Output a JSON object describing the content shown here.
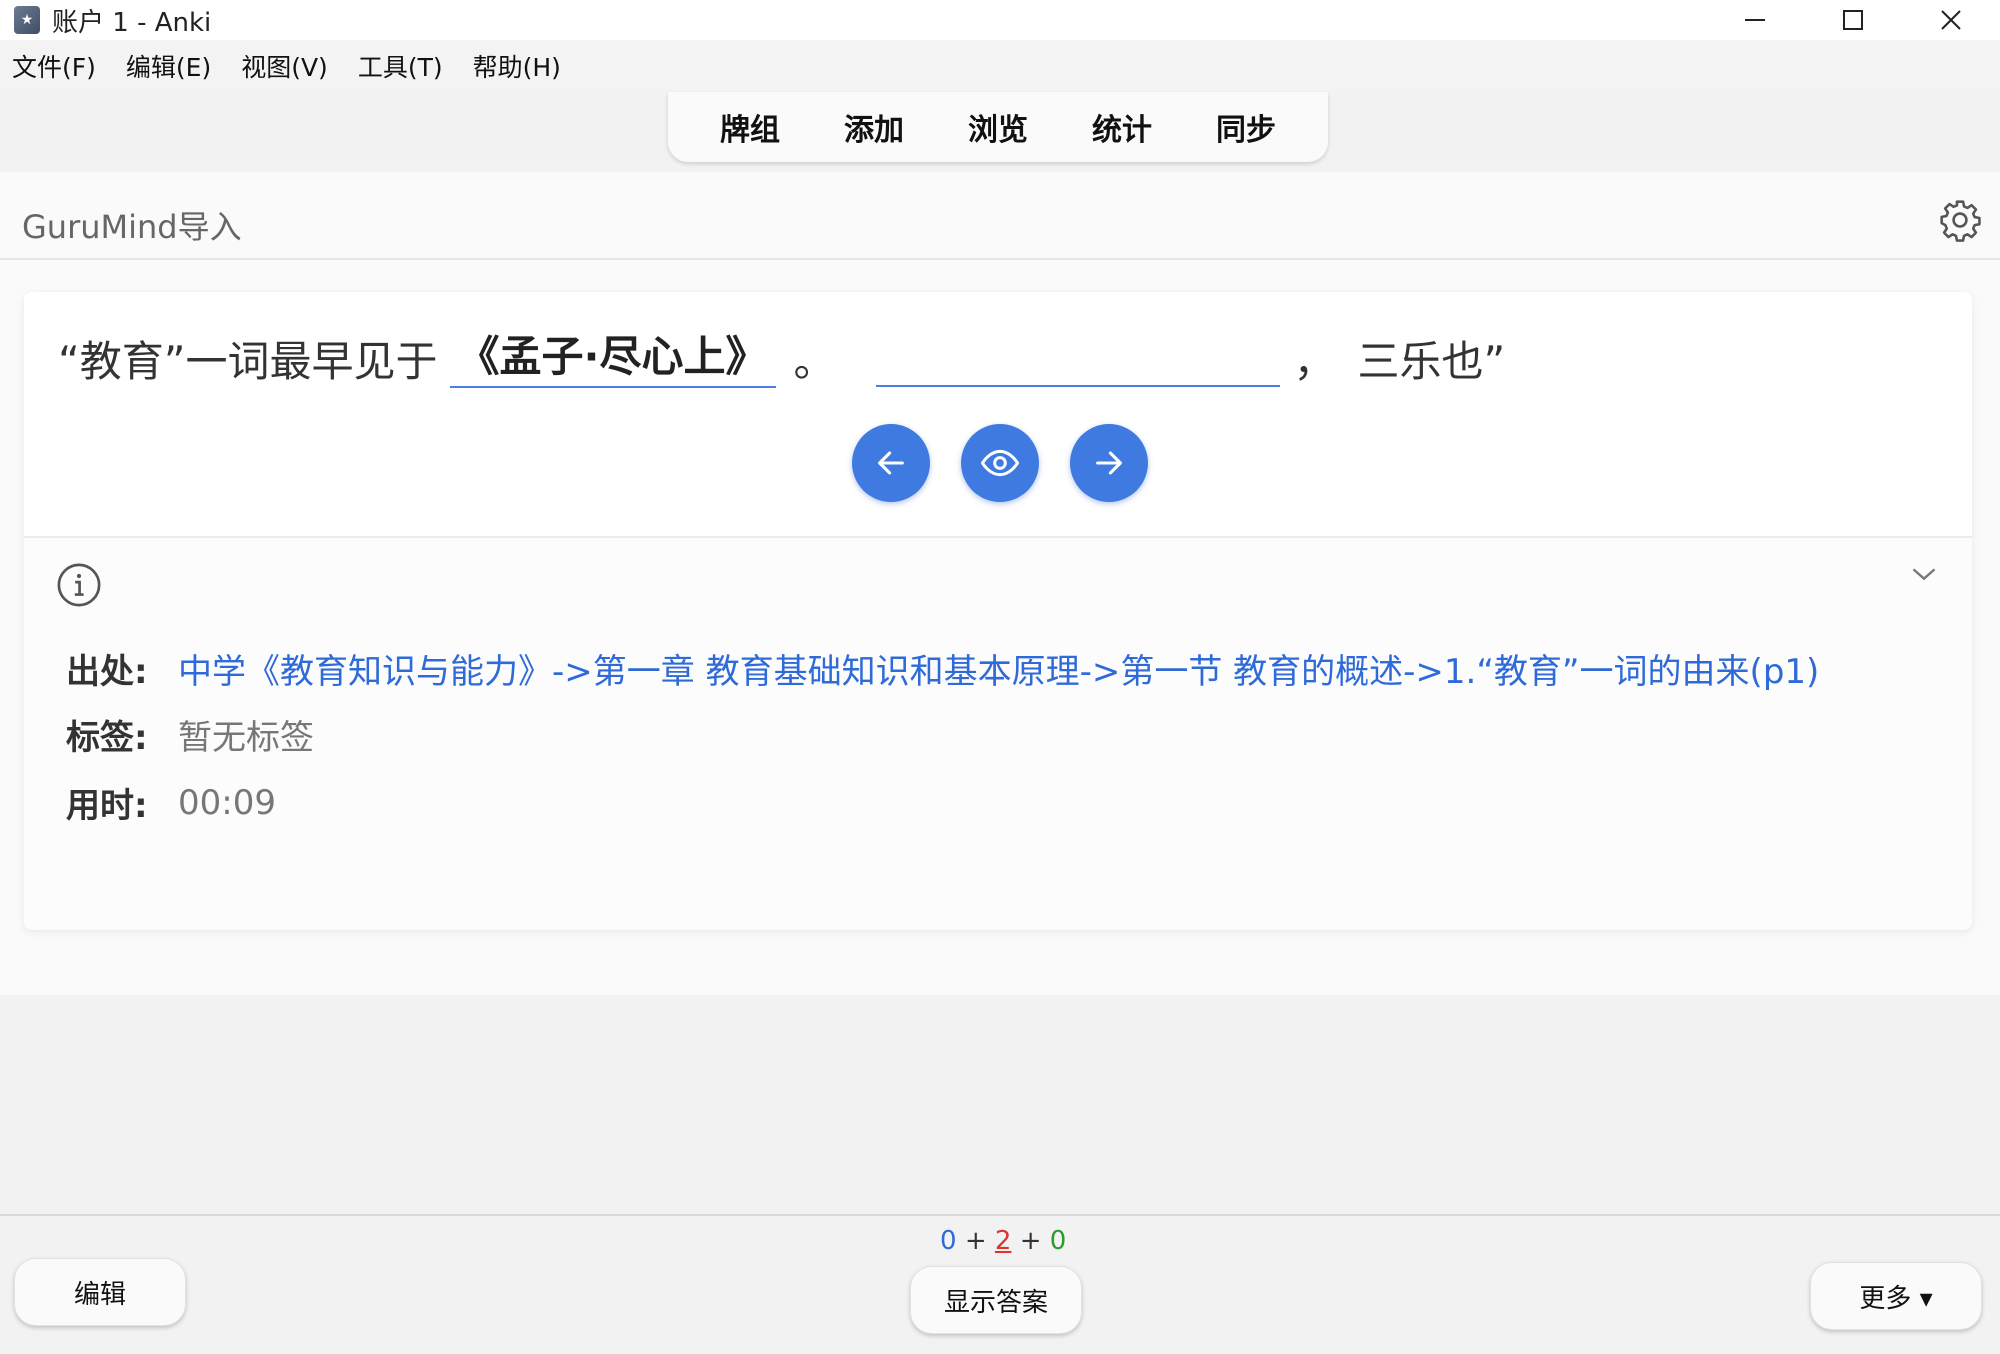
{
  "window": {
    "title": "账户 1 - Anki",
    "minimize_label": "—",
    "maximize_label": "☐",
    "close_label": "✕"
  },
  "menu": [
    "文件(F)",
    "编辑(E)",
    "视图(V)",
    "工具(T)",
    "帮助(H)"
  ],
  "toolbar": [
    "牌组",
    "添加",
    "浏览",
    "统计",
    "同步"
  ],
  "deck": {
    "title": "GuruMind导入"
  },
  "card": {
    "question_prefix": "“教育”一词最早见于",
    "answer_shown": "《孟子·尽心上》",
    "period": "。",
    "comma": "，",
    "question_suffix": "三乐也”"
  },
  "meta": {
    "source_label": "出处:",
    "source_value": "中学《教育知识与能力》->第一章 教育基础知识和基本原理->第一节 教育的概述->1.“教育”一词的由来(p1)",
    "tags_label": "标签:",
    "tags_value": "暂无标签",
    "time_label": "用时:",
    "time_value": "00:09"
  },
  "counts": {
    "new": "0",
    "plus1": "+",
    "learn": "2",
    "plus2": "+",
    "review": "0"
  },
  "bottom": {
    "edit_label": "编辑",
    "show_answer_label": "显示答案",
    "more_label": "更多 ▾"
  },
  "colors": {
    "accent_blue": "#3f7ae0",
    "link_blue": "#2f6ad9",
    "learn_red": "#dd3333",
    "review_green": "#2a9d2a"
  }
}
